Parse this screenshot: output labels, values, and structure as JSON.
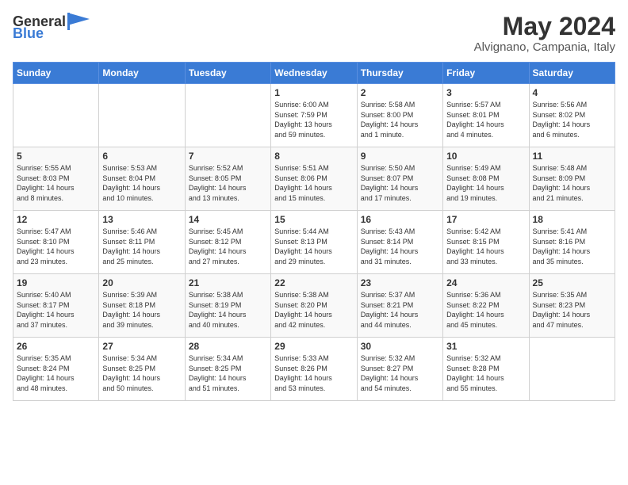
{
  "header": {
    "logo_general": "General",
    "logo_blue": "Blue",
    "month_year": "May 2024",
    "location": "Alvignano, Campania, Italy"
  },
  "days_of_week": [
    "Sunday",
    "Monday",
    "Tuesday",
    "Wednesday",
    "Thursday",
    "Friday",
    "Saturday"
  ],
  "weeks": [
    [
      {
        "day": "",
        "info": ""
      },
      {
        "day": "",
        "info": ""
      },
      {
        "day": "",
        "info": ""
      },
      {
        "day": "1",
        "info": "Sunrise: 6:00 AM\nSunset: 7:59 PM\nDaylight: 13 hours\nand 59 minutes."
      },
      {
        "day": "2",
        "info": "Sunrise: 5:58 AM\nSunset: 8:00 PM\nDaylight: 14 hours\nand 1 minute."
      },
      {
        "day": "3",
        "info": "Sunrise: 5:57 AM\nSunset: 8:01 PM\nDaylight: 14 hours\nand 4 minutes."
      },
      {
        "day": "4",
        "info": "Sunrise: 5:56 AM\nSunset: 8:02 PM\nDaylight: 14 hours\nand 6 minutes."
      }
    ],
    [
      {
        "day": "5",
        "info": "Sunrise: 5:55 AM\nSunset: 8:03 PM\nDaylight: 14 hours\nand 8 minutes."
      },
      {
        "day": "6",
        "info": "Sunrise: 5:53 AM\nSunset: 8:04 PM\nDaylight: 14 hours\nand 10 minutes."
      },
      {
        "day": "7",
        "info": "Sunrise: 5:52 AM\nSunset: 8:05 PM\nDaylight: 14 hours\nand 13 minutes."
      },
      {
        "day": "8",
        "info": "Sunrise: 5:51 AM\nSunset: 8:06 PM\nDaylight: 14 hours\nand 15 minutes."
      },
      {
        "day": "9",
        "info": "Sunrise: 5:50 AM\nSunset: 8:07 PM\nDaylight: 14 hours\nand 17 minutes."
      },
      {
        "day": "10",
        "info": "Sunrise: 5:49 AM\nSunset: 8:08 PM\nDaylight: 14 hours\nand 19 minutes."
      },
      {
        "day": "11",
        "info": "Sunrise: 5:48 AM\nSunset: 8:09 PM\nDaylight: 14 hours\nand 21 minutes."
      }
    ],
    [
      {
        "day": "12",
        "info": "Sunrise: 5:47 AM\nSunset: 8:10 PM\nDaylight: 14 hours\nand 23 minutes."
      },
      {
        "day": "13",
        "info": "Sunrise: 5:46 AM\nSunset: 8:11 PM\nDaylight: 14 hours\nand 25 minutes."
      },
      {
        "day": "14",
        "info": "Sunrise: 5:45 AM\nSunset: 8:12 PM\nDaylight: 14 hours\nand 27 minutes."
      },
      {
        "day": "15",
        "info": "Sunrise: 5:44 AM\nSunset: 8:13 PM\nDaylight: 14 hours\nand 29 minutes."
      },
      {
        "day": "16",
        "info": "Sunrise: 5:43 AM\nSunset: 8:14 PM\nDaylight: 14 hours\nand 31 minutes."
      },
      {
        "day": "17",
        "info": "Sunrise: 5:42 AM\nSunset: 8:15 PM\nDaylight: 14 hours\nand 33 minutes."
      },
      {
        "day": "18",
        "info": "Sunrise: 5:41 AM\nSunset: 8:16 PM\nDaylight: 14 hours\nand 35 minutes."
      }
    ],
    [
      {
        "day": "19",
        "info": "Sunrise: 5:40 AM\nSunset: 8:17 PM\nDaylight: 14 hours\nand 37 minutes."
      },
      {
        "day": "20",
        "info": "Sunrise: 5:39 AM\nSunset: 8:18 PM\nDaylight: 14 hours\nand 39 minutes."
      },
      {
        "day": "21",
        "info": "Sunrise: 5:38 AM\nSunset: 8:19 PM\nDaylight: 14 hours\nand 40 minutes."
      },
      {
        "day": "22",
        "info": "Sunrise: 5:38 AM\nSunset: 8:20 PM\nDaylight: 14 hours\nand 42 minutes."
      },
      {
        "day": "23",
        "info": "Sunrise: 5:37 AM\nSunset: 8:21 PM\nDaylight: 14 hours\nand 44 minutes."
      },
      {
        "day": "24",
        "info": "Sunrise: 5:36 AM\nSunset: 8:22 PM\nDaylight: 14 hours\nand 45 minutes."
      },
      {
        "day": "25",
        "info": "Sunrise: 5:35 AM\nSunset: 8:23 PM\nDaylight: 14 hours\nand 47 minutes."
      }
    ],
    [
      {
        "day": "26",
        "info": "Sunrise: 5:35 AM\nSunset: 8:24 PM\nDaylight: 14 hours\nand 48 minutes."
      },
      {
        "day": "27",
        "info": "Sunrise: 5:34 AM\nSunset: 8:25 PM\nDaylight: 14 hours\nand 50 minutes."
      },
      {
        "day": "28",
        "info": "Sunrise: 5:34 AM\nSunset: 8:25 PM\nDaylight: 14 hours\nand 51 minutes."
      },
      {
        "day": "29",
        "info": "Sunrise: 5:33 AM\nSunset: 8:26 PM\nDaylight: 14 hours\nand 53 minutes."
      },
      {
        "day": "30",
        "info": "Sunrise: 5:32 AM\nSunset: 8:27 PM\nDaylight: 14 hours\nand 54 minutes."
      },
      {
        "day": "31",
        "info": "Sunrise: 5:32 AM\nSunset: 8:28 PM\nDaylight: 14 hours\nand 55 minutes."
      },
      {
        "day": "",
        "info": ""
      }
    ]
  ]
}
